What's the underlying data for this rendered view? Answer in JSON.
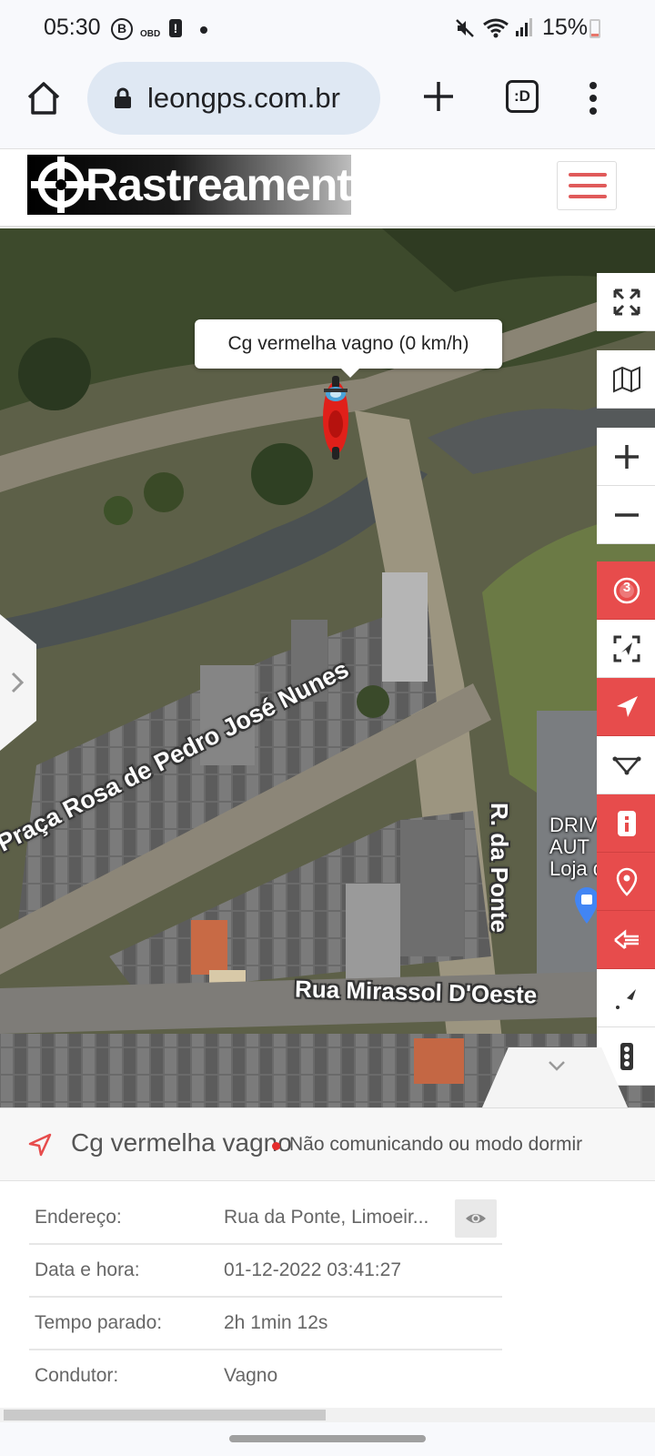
{
  "status_bar": {
    "time": "05:30",
    "battery": "15%",
    "battery_level": 0.15,
    "icons": [
      "b-circle-icon",
      "obd-icon",
      "alert-icon",
      "dot-icon",
      "mute-icon",
      "wifi-icon",
      "signal-icon",
      "battery-icon"
    ],
    "b_glyph": "B",
    "obd_glyph": "OBD",
    "alert_glyph": "!"
  },
  "browser": {
    "url": "leongps.com.br",
    "tabs_glyph": ":D",
    "icons": [
      "home-icon",
      "lock-icon",
      "plus-icon",
      "tabs-icon",
      "more-vert-icon"
    ]
  },
  "site": {
    "logo_text": "Rastreamento",
    "menu_icon": "hamburger-icon"
  },
  "map": {
    "popup_label": "Cg vermelha vagno (0 km/h)",
    "streets": {
      "praca": "Praça Rosa de Pedro José Nunes",
      "ponte": "R. da Ponte",
      "mirassol": "Rua Mirassol D'Oeste"
    },
    "poi": {
      "line1": "DRIV",
      "line2": "AUT",
      "line3": "Loja d"
    },
    "tools_badge": "3",
    "tool_icons": [
      "fullscreen-icon",
      "map-layers-icon",
      "zoom-in-icon",
      "zoom-out-icon",
      "speed-badge-icon",
      "focus-vehicle-icon",
      "navigate-icon",
      "route-icon",
      "info-icon",
      "location-pin-icon",
      "history-icon",
      "draw-icon",
      "traffic-light-icon"
    ]
  },
  "info_panel": {
    "vehicle_name": "Cg vermelha vagno",
    "status_text": "Não comunicando ou modo dormir",
    "status_color": "#e52d2d",
    "rows": [
      {
        "label": "Endereço:",
        "value": "Rua da Ponte, Limoeir..."
      },
      {
        "label": "Data e hora:",
        "value": "01-12-2022 03:41:27"
      },
      {
        "label": "Tempo parado:",
        "value": "2h 1min 12s"
      },
      {
        "label": "Condutor:",
        "value": "Vagno"
      }
    ]
  },
  "colors": {
    "accent_red": "#e74c4c",
    "hamburger_red": "#e05a5a",
    "url_pill": "#dfe8f3"
  }
}
